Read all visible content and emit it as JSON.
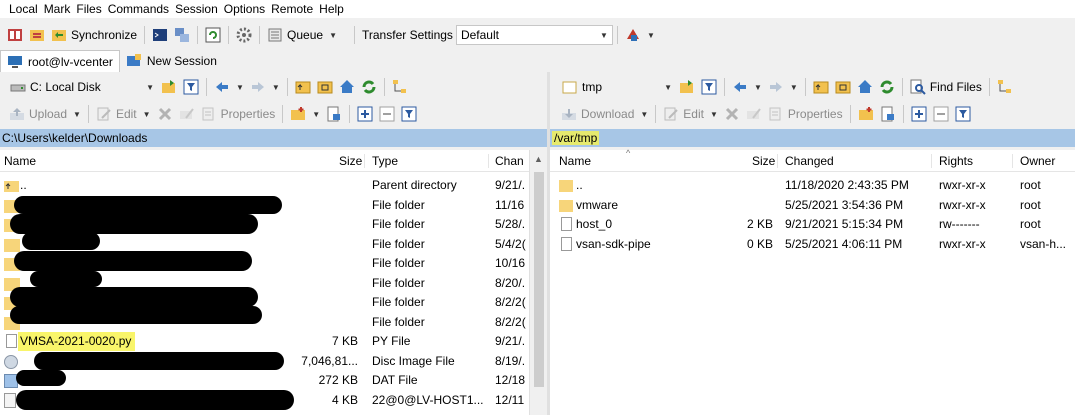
{
  "menu": [
    "Local",
    "Mark",
    "Files",
    "Commands",
    "Session",
    "Options",
    "Remote",
    "Help"
  ],
  "toolbar": {
    "synchronize": "Synchronize",
    "queue": "Queue",
    "transfer_settings_label": "Transfer Settings",
    "transfer_settings_value": "Default"
  },
  "tabs": [
    {
      "label": "root@lv-vcenter",
      "active": true
    },
    {
      "label": "New Session",
      "active": false
    }
  ],
  "left": {
    "drive": "C: Local Disk",
    "actions": {
      "upload": "Upload",
      "edit": "Edit",
      "properties": "Properties"
    },
    "path": "C:\\Users\\kelder\\Downloads",
    "columns": [
      "Name",
      "Size",
      "Type",
      "Chan"
    ],
    "rows": [
      {
        "name": "..",
        "size": "",
        "type": "Parent directory",
        "changed": "9/21/."
      },
      {
        "name": "",
        "size": "",
        "type": "File folder",
        "changed": "11/16"
      },
      {
        "name": "",
        "size": "",
        "type": "File folder",
        "changed": "5/28/."
      },
      {
        "name": "",
        "size": "",
        "type": "File folder",
        "changed": "5/4/2("
      },
      {
        "name": "",
        "size": "",
        "type": "File folder",
        "changed": "10/16"
      },
      {
        "name": "",
        "size": "",
        "type": "File folder",
        "changed": "8/20/."
      },
      {
        "name": "",
        "size": "",
        "type": "File folder",
        "changed": "8/2/2("
      },
      {
        "name": "",
        "size": "",
        "type": "File folder",
        "changed": "8/2/2("
      },
      {
        "name": "VMSA-2021-0020.py",
        "size": "7 KB",
        "type": "PY File",
        "changed": "9/21/."
      },
      {
        "name": "",
        "size": "7,046,81...",
        "type": "Disc Image File",
        "changed": "8/19/."
      },
      {
        "name": "",
        "size": "272 KB",
        "type": "DAT File",
        "changed": "12/18"
      },
      {
        "name": "",
        "size": "4 KB",
        "type": "22@0@LV-HOST1...",
        "changed": "12/11"
      }
    ]
  },
  "right": {
    "dir": "tmp",
    "find_files": "Find Files",
    "actions": {
      "download": "Download",
      "edit": "Edit",
      "properties": "Properties"
    },
    "path": "/var/tmp",
    "columns": [
      "Name",
      "Size",
      "Changed",
      "Rights",
      "Owner"
    ],
    "rows": [
      {
        "name": "..",
        "size": "",
        "changed": "11/18/2020 2:43:35 PM",
        "rights": "rwxr-xr-x",
        "owner": "root",
        "kind": "folder"
      },
      {
        "name": "vmware",
        "size": "",
        "changed": "5/25/2021 3:54:36 PM",
        "rights": "rwxr-xr-x",
        "owner": "root",
        "kind": "folder"
      },
      {
        "name": "host_0",
        "size": "2 KB",
        "changed": "9/21/2021 5:15:34 PM",
        "rights": "rw-------",
        "owner": "root",
        "kind": "file"
      },
      {
        "name": "vsan-sdk-pipe",
        "size": "0 KB",
        "changed": "5/25/2021 4:06:11 PM",
        "rights": "rwxr-xr-x",
        "owner": "vsan-h...",
        "kind": "file"
      }
    ]
  }
}
